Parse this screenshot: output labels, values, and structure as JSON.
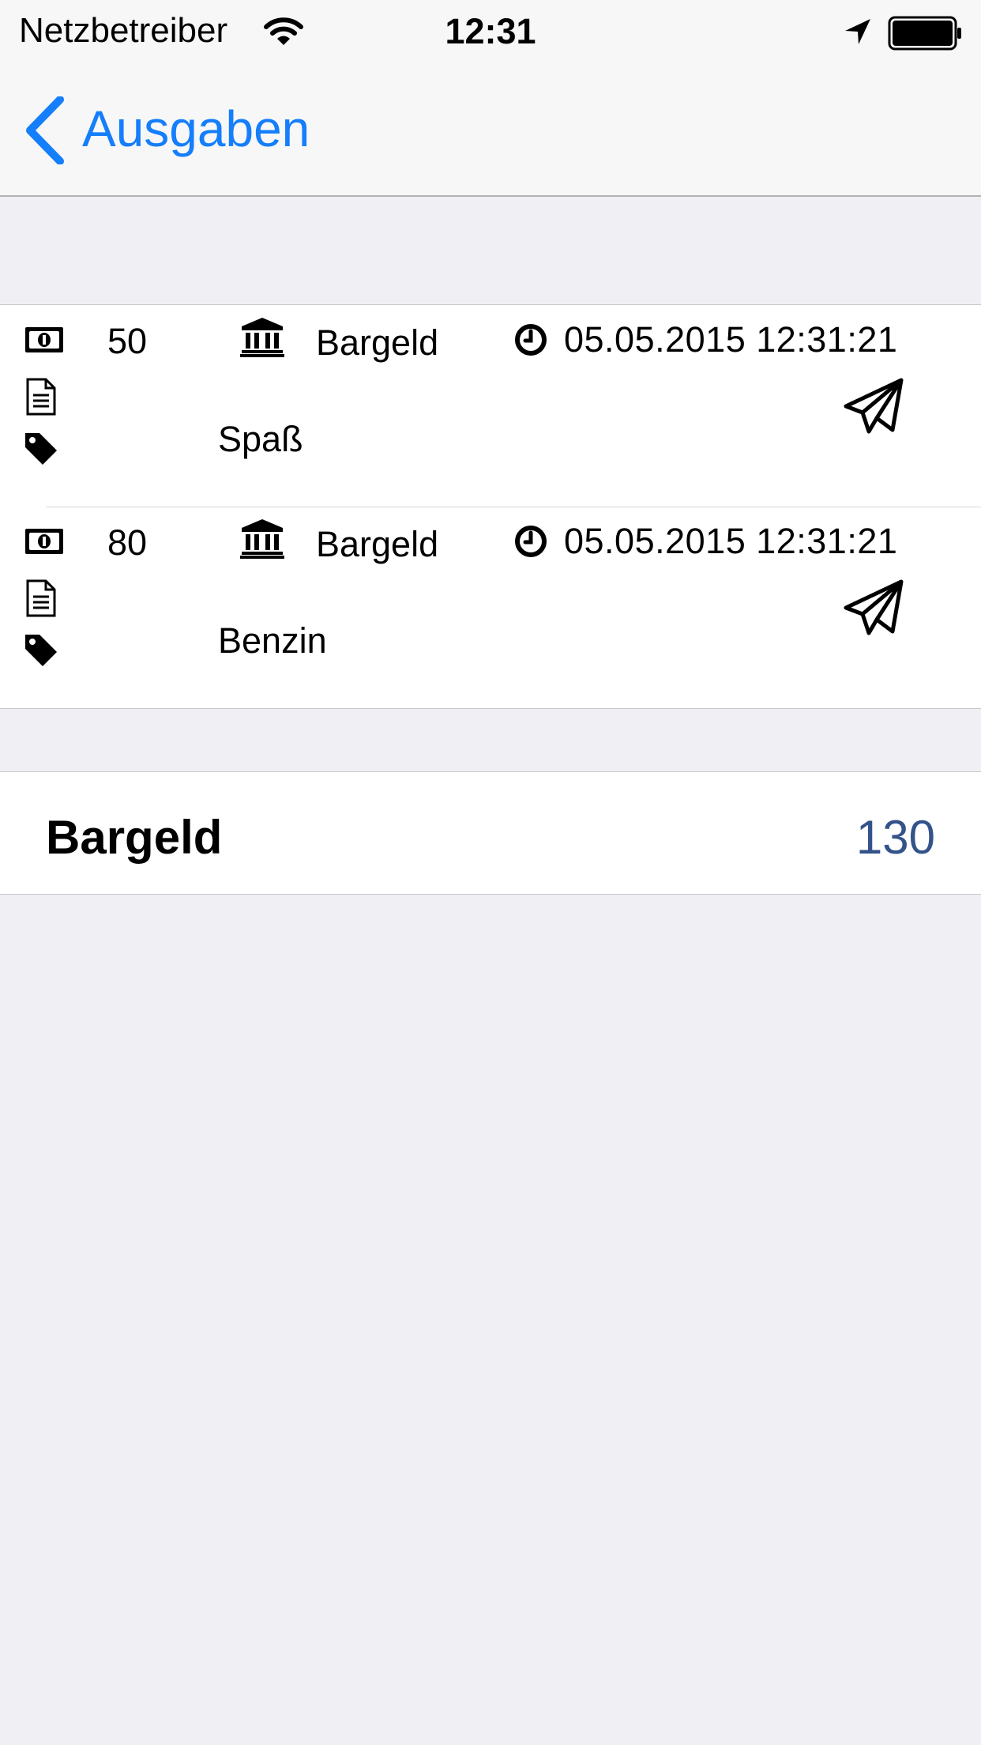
{
  "status_bar": {
    "carrier": "Netzbetreiber",
    "time": "12:31"
  },
  "nav": {
    "back_label": "Ausgaben"
  },
  "colors": {
    "accent": "#157efb",
    "total_value": "#34538a",
    "background": "#efeff4"
  },
  "icons": [
    "cash-icon",
    "bank-icon",
    "clock-icon",
    "document-icon",
    "tag-icon",
    "paper-plane-icon",
    "wifi-icon",
    "location-arrow-icon",
    "battery-icon",
    "chevron-left-icon"
  ],
  "entries": [
    {
      "amount": "50",
      "account": "Bargeld",
      "datetime": "05.05.2015 12:31:21",
      "category": "Spaß"
    },
    {
      "amount": "80",
      "account": "Bargeld",
      "datetime": "05.05.2015 12:31:21",
      "category": "Benzin"
    }
  ],
  "total": {
    "label": "Bargeld",
    "value": "130"
  }
}
